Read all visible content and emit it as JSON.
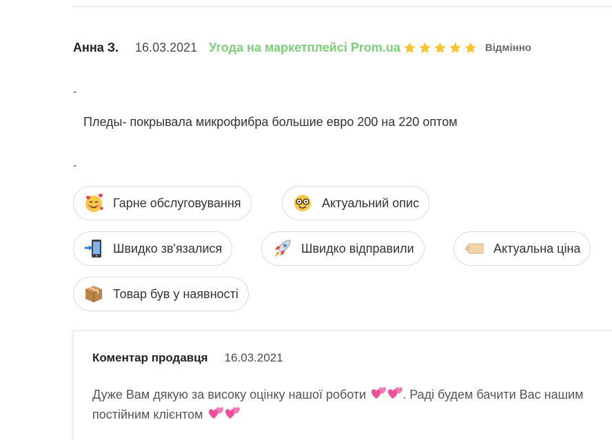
{
  "review": {
    "author": "Анна З.",
    "date": "16.03.2021",
    "source": "Угода на маркетплейсі Prom.ua",
    "rating": 5,
    "rating_max": 5,
    "rating_label": "Відмінно",
    "dash_1": "-",
    "text": "Пледы- покрывала микрофибра большие евро 200 на 220 оптом",
    "dash_2": "-"
  },
  "tags": [
    {
      "label": "Гарне обслуговування",
      "icon": "smiling-face-with-hearts-icon"
    },
    {
      "label": "Актуальний опис",
      "icon": "nerd-face-icon"
    },
    {
      "label": "Швидко зв'язалися",
      "icon": "mobile-phone-arrow-icon"
    },
    {
      "label": "Швидко відправили",
      "icon": "rocket-icon"
    },
    {
      "label": "Актуальна ціна",
      "icon": "price-tag-icon"
    },
    {
      "label": "Товар був у наявності",
      "icon": "package-icon"
    }
  ],
  "seller_comment": {
    "title": "Коментар продавця",
    "date": "16.03.2021",
    "text_part1": "Дуже Вам дякую за високу оцінку нашої роботи",
    "text_part2": ". Раді будем бачити Вас нашим постійним клієнтом",
    "emoji": "two-hearts-icon"
  },
  "colors": {
    "source_green": "#7ccf77",
    "star_yellow": "#f7c531",
    "heart_pink": "#f0509a"
  }
}
